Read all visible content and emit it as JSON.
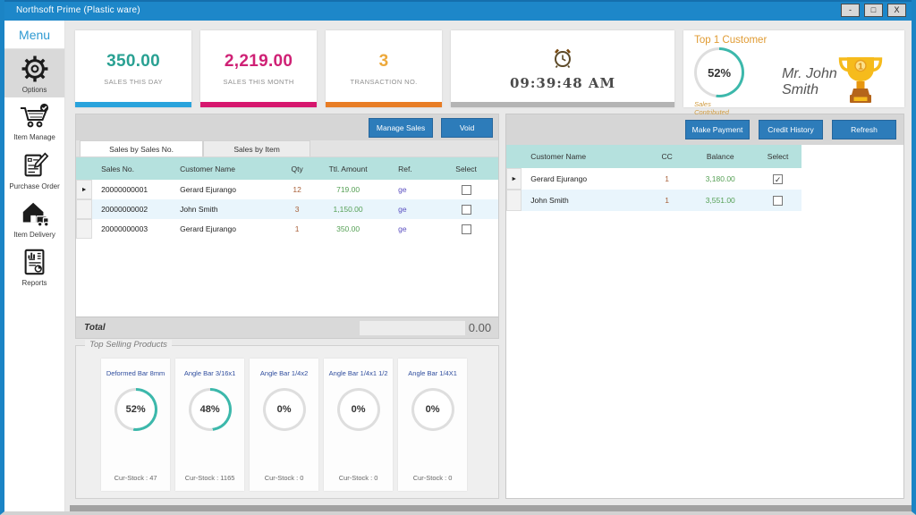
{
  "colors": {
    "ring_teal": "#3cb8ab",
    "ring_track": "#dedede",
    "titlebar_blue": "#1d87c9",
    "button_blue": "#2d7cba",
    "grid_header_teal": "#b5e1de"
  },
  "window": {
    "title": "Northsoft Prime (Plastic ware)",
    "controls": {
      "minimize": "-",
      "maximize": "□",
      "close": "X"
    }
  },
  "sidebar": {
    "header": "Menu",
    "items": [
      {
        "label": "Options"
      },
      {
        "label": "Item Manage"
      },
      {
        "label": "Purchase Order"
      },
      {
        "label": "Item Delivery"
      },
      {
        "label": "Reports"
      }
    ]
  },
  "stats": {
    "cards": [
      {
        "value": "350.00",
        "label": "SALES THIS DAY",
        "value_color": "#2aa193",
        "bar_color": "#29a3dc"
      },
      {
        "value": "2,219.00",
        "label": "SALES THIS MONTH",
        "value_color": "#cf2175",
        "bar_color": "#d6176e"
      },
      {
        "value": "3",
        "label": "TRANSACTION NO.",
        "value_color": "#eda93c",
        "bar_color": "#e87d25"
      }
    ],
    "clock": {
      "time": "09:39:48 AM",
      "bar_color": "#b4b4b4"
    },
    "top_customer": {
      "heading": "Top 1 Customer",
      "percent": "52%",
      "pct": 52,
      "caption": "Sales Contributed",
      "name": "Mr. John Smith",
      "rank": "1"
    }
  },
  "sales_panel": {
    "buttons": {
      "manage": "Manage Sales",
      "void": "Void"
    },
    "tabs": [
      {
        "label": "Sales by Sales No."
      },
      {
        "label": "Sales by Item"
      }
    ],
    "columns": {
      "sales_no": "Sales No.",
      "customer": "Customer Name",
      "qty": "Qty",
      "amount": "Ttl. Amount",
      "ref": "Ref.",
      "select": "Select"
    },
    "rows": [
      {
        "arrow": "►",
        "sales_no": "20000000001",
        "customer": "Gerard Ejurango",
        "qty": "12",
        "amount": "719.00",
        "ref": "ge",
        "check": ""
      },
      {
        "arrow": "",
        "sales_no": "20000000002",
        "customer": "John Smith",
        "qty": "3",
        "amount": "1,150.00",
        "ref": "ge",
        "check": ""
      },
      {
        "arrow": "",
        "sales_no": "20000000003",
        "customer": "Gerard Ejurango",
        "qty": "1",
        "amount": "350.00",
        "ref": "ge",
        "check": ""
      }
    ],
    "total_label": "Total",
    "total_value": "0.00"
  },
  "top_selling": {
    "legend": "Top Selling Products",
    "products": [
      {
        "name": "Deformed Bar 8mm",
        "percent": "52%",
        "pct": 52,
        "stock": "Cur-Stock : 47"
      },
      {
        "name": "Angle Bar 3/16x1",
        "percent": "48%",
        "pct": 48,
        "stock": "Cur-Stock : 1165"
      },
      {
        "name": "Angle Bar 1/4x2",
        "percent": "0%",
        "pct": 0,
        "stock": "Cur-Stock : 0"
      },
      {
        "name": "Angle Bar 1/4x1 1/2",
        "percent": "0%",
        "pct": 0,
        "stock": "Cur-Stock : 0"
      },
      {
        "name": "Angle Bar 1/4X1",
        "percent": "0%",
        "pct": 0,
        "stock": "Cur-Stock : 0"
      }
    ]
  },
  "customer_panel": {
    "buttons": {
      "make_payment": "Make Payment",
      "credit_history": "Credit History",
      "refresh": "Refresh"
    },
    "columns": {
      "name": "Customer Name",
      "cc": "CC",
      "balance": "Balance",
      "select": "Select"
    },
    "rows": [
      {
        "arrow": "►",
        "name": "Gerard Ejurango",
        "cc": "1",
        "balance": "3,180.00",
        "check": "✓"
      },
      {
        "arrow": "",
        "name": "John Smith",
        "cc": "1",
        "balance": "3,551.00",
        "check": ""
      }
    ]
  }
}
